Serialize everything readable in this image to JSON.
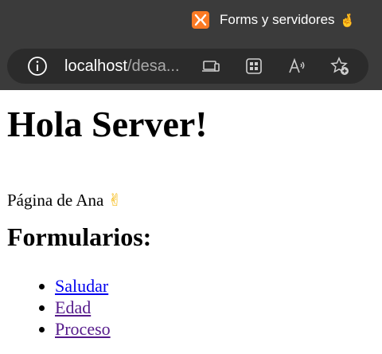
{
  "browser": {
    "tab": {
      "title": "Forms y servidores",
      "emoji": "🤞"
    },
    "address": {
      "host": "localhost",
      "path": "/desa..."
    }
  },
  "page": {
    "title": "Hola Server!",
    "owner_text": "Página de Ana",
    "owner_emoji": "✌",
    "section_title": "Formularios:",
    "links": [
      {
        "label": "Saludar",
        "visited": false
      },
      {
        "label": "Edad",
        "visited": true
      },
      {
        "label": "Proceso",
        "visited": true
      }
    ]
  },
  "colors": {
    "chrome": "#3b3b3b",
    "address_bar": "#2b2b2b",
    "favicon": "#fb7a24",
    "link": "#0000ee",
    "visited_link": "#551a8b"
  }
}
